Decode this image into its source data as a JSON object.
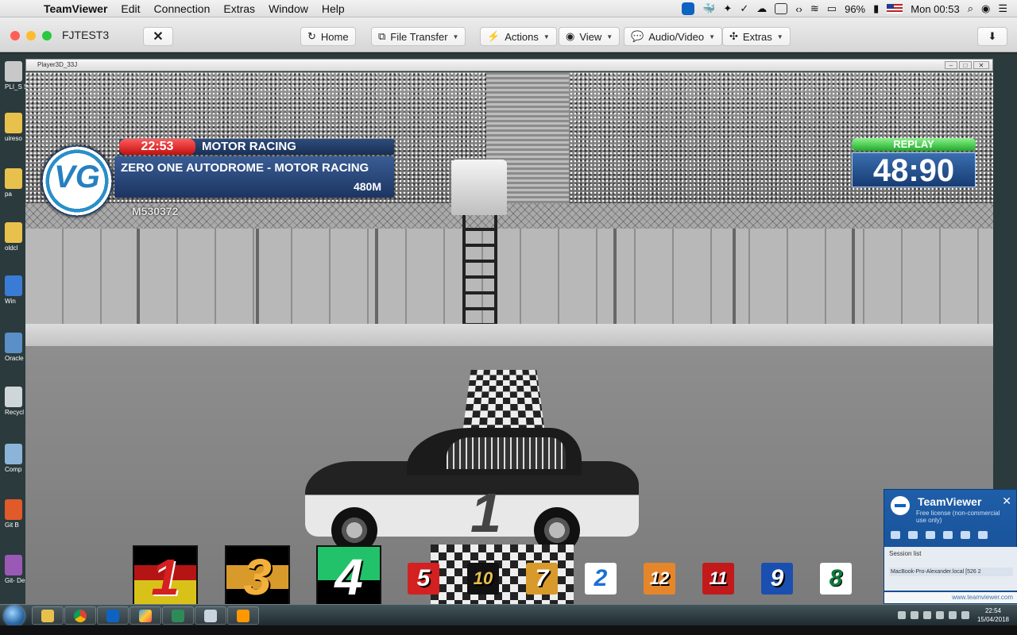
{
  "menubar": {
    "app_name": "TeamViewer",
    "items": [
      "Edit",
      "Connection",
      "Extras",
      "Window",
      "Help"
    ],
    "battery": "96%",
    "clock": "Mon 00:53"
  },
  "toolbar": {
    "title": "FJTEST3",
    "buttons": {
      "home": "Home",
      "file_transfer": "File Transfer",
      "actions": "Actions",
      "view": "View",
      "audio_video": "Audio/Video",
      "extras": "Extras"
    }
  },
  "remote": {
    "player_window_title": "Player3D_33J",
    "desktop_labels": [
      "PLI_S\nShor",
      "uireso",
      "pa",
      "oldcl",
      "Win",
      "Oracle\nVirtual",
      "Recycl",
      "Comp",
      "Git B",
      "Git-\nDesk"
    ]
  },
  "overlay": {
    "race_time": "22:53",
    "event_type": "MOTOR RACING",
    "venue": "ZERO ONE AUTODROME - MOTOR RACING",
    "distance": "480M",
    "race_code": "M530372",
    "replay_label": "REPLAY",
    "replay_clock": "48:90"
  },
  "finish": {
    "podium": [
      {
        "number": "1",
        "place": "1"
      },
      {
        "number": "3",
        "place": "2"
      },
      {
        "number": "4",
        "place": "3"
      }
    ],
    "others": [
      "5",
      "10",
      "7",
      "2",
      "12",
      "11",
      "9",
      "8"
    ],
    "colors": {
      "gold": "#d89a2a",
      "green": "#21c26a",
      "red": "#d32020",
      "blue": "#1a6fd4"
    }
  },
  "car": {
    "number": "1"
  },
  "tv_popup": {
    "title": "TeamViewer",
    "subtitle": "Free license (non-commercial use only)",
    "session_header": "Session list",
    "session_item": "MacBook-Pro-Alexander.local [526 2",
    "link": "www.teamviewer.com"
  },
  "taskbar": {
    "time": "22:54",
    "date": "15/04/2018"
  }
}
